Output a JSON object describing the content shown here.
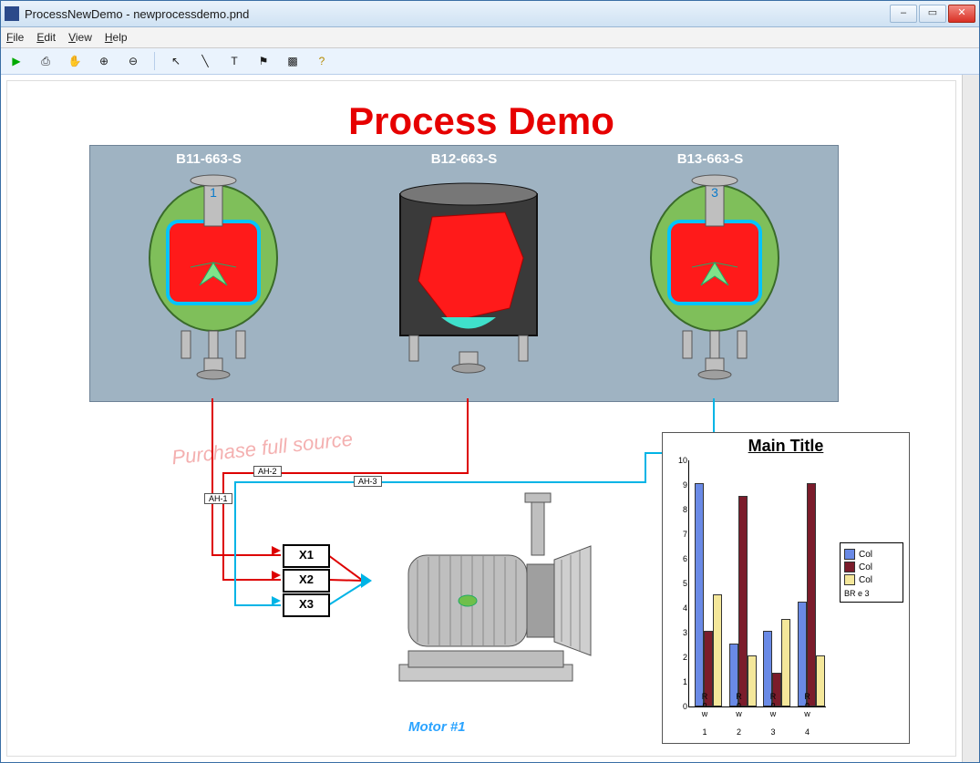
{
  "window": {
    "title": "ProcessNewDemo - newprocessdemo.pnd"
  },
  "menu": {
    "file": "File",
    "edit": "Edit",
    "view": "View",
    "help": "Help"
  },
  "toolbar_icons": [
    "run-icon",
    "print-icon",
    "hand-icon",
    "zoom-in-icon",
    "zoom-out-icon",
    "pointer-icon",
    "line-icon",
    "text-icon",
    "flags-icon",
    "chart-icon",
    "help-icon"
  ],
  "canvas": {
    "title": "Process Demo",
    "watermark": "Purchase full source",
    "tanks": [
      {
        "id": "B11-663-S",
        "badge": "1"
      },
      {
        "id": "B12-663-S",
        "badge": ""
      },
      {
        "id": "B13-663-S",
        "badge": "3"
      }
    ],
    "pipes": [
      {
        "id": "AH-1"
      },
      {
        "id": "AH-2"
      },
      {
        "id": "AH-3"
      }
    ],
    "x_boxes": [
      "X1",
      "X2",
      "X3"
    ],
    "motor_label": "Motor #1"
  },
  "chart_data": {
    "type": "bar",
    "title": "Main Title",
    "ylim": [
      0,
      10
    ],
    "categories": [
      "Row 1",
      "Row 2",
      "Row 3",
      "Row 4"
    ],
    "series": [
      {
        "name": "Col",
        "color": "#6a8ae6",
        "values": [
          9,
          2.5,
          3,
          4.2
        ]
      },
      {
        "name": "Col",
        "color": "#7b1c2b",
        "values": [
          3,
          8.5,
          1.3,
          9
        ]
      },
      {
        "name": "Col",
        "color": "#f4e79a",
        "values": [
          4.5,
          2,
          3.5,
          2
        ]
      }
    ],
    "legend_footer": "BR e 3"
  }
}
